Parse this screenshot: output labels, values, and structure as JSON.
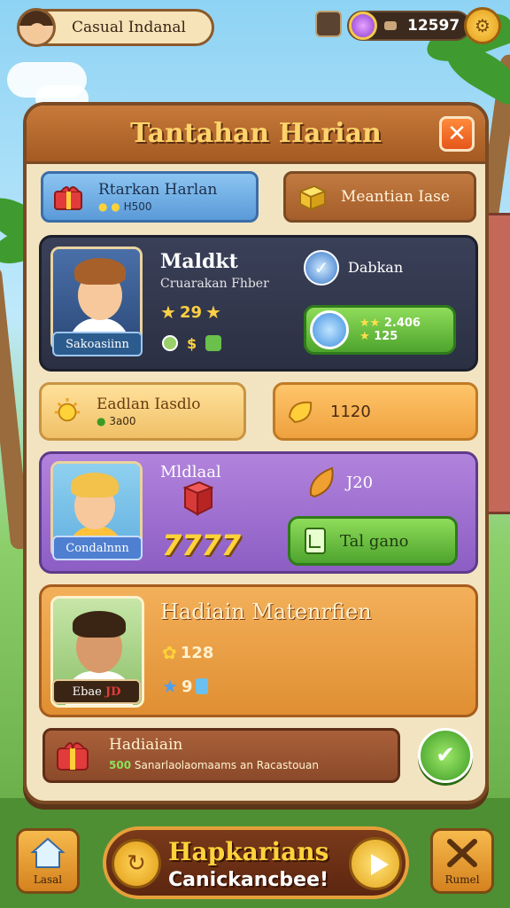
{
  "profile": {
    "name": "Casual Indanal"
  },
  "resources": {
    "gems": "12597"
  },
  "panel": {
    "title": "Tantahan Harian",
    "close_symbol": "✕",
    "chips": {
      "blue": {
        "title": "Rtarkan Harlan",
        "sub": "H500"
      },
      "orange": {
        "title": "Meantian Iase"
      },
      "yellow": {
        "title": "Eadlan Iasdlo",
        "sub": "3a00"
      },
      "amber": {
        "value": "1120"
      },
      "brown": {
        "title": "Hadiaiain",
        "sub": "Sanarlaolaomaams an Racastouan",
        "badge": "500"
      }
    },
    "card_dark": {
      "name": "Maldkt",
      "sub": "Cruarakan Fhber",
      "stars": "29",
      "tag": "Sakoasiinn",
      "action_label": "Dabkan",
      "reward_1": "2.406",
      "reward_2": "125",
      "small_icons": [
        "$"
      ]
    },
    "card_purple": {
      "name": "Mldlaal",
      "tag": "Condalnnn",
      "value": "J20",
      "bonus": "7777",
      "button_label": "Tal gano"
    },
    "card_orange": {
      "name": "Hadiain Matenrfien",
      "value_1": "128",
      "value_2": "9",
      "tag": "Ebae",
      "tag_value": "JD"
    }
  },
  "bottom": {
    "left_label": "Lasal",
    "big_title": "Hapkarians",
    "big_sub": "Canickancbee!",
    "right_label": "Rumel"
  },
  "colors": {
    "panel_bg": "#f3e4c1",
    "header": "#b8652c",
    "title_gold": "#ffd36b",
    "accent_green": "#4da42d"
  }
}
